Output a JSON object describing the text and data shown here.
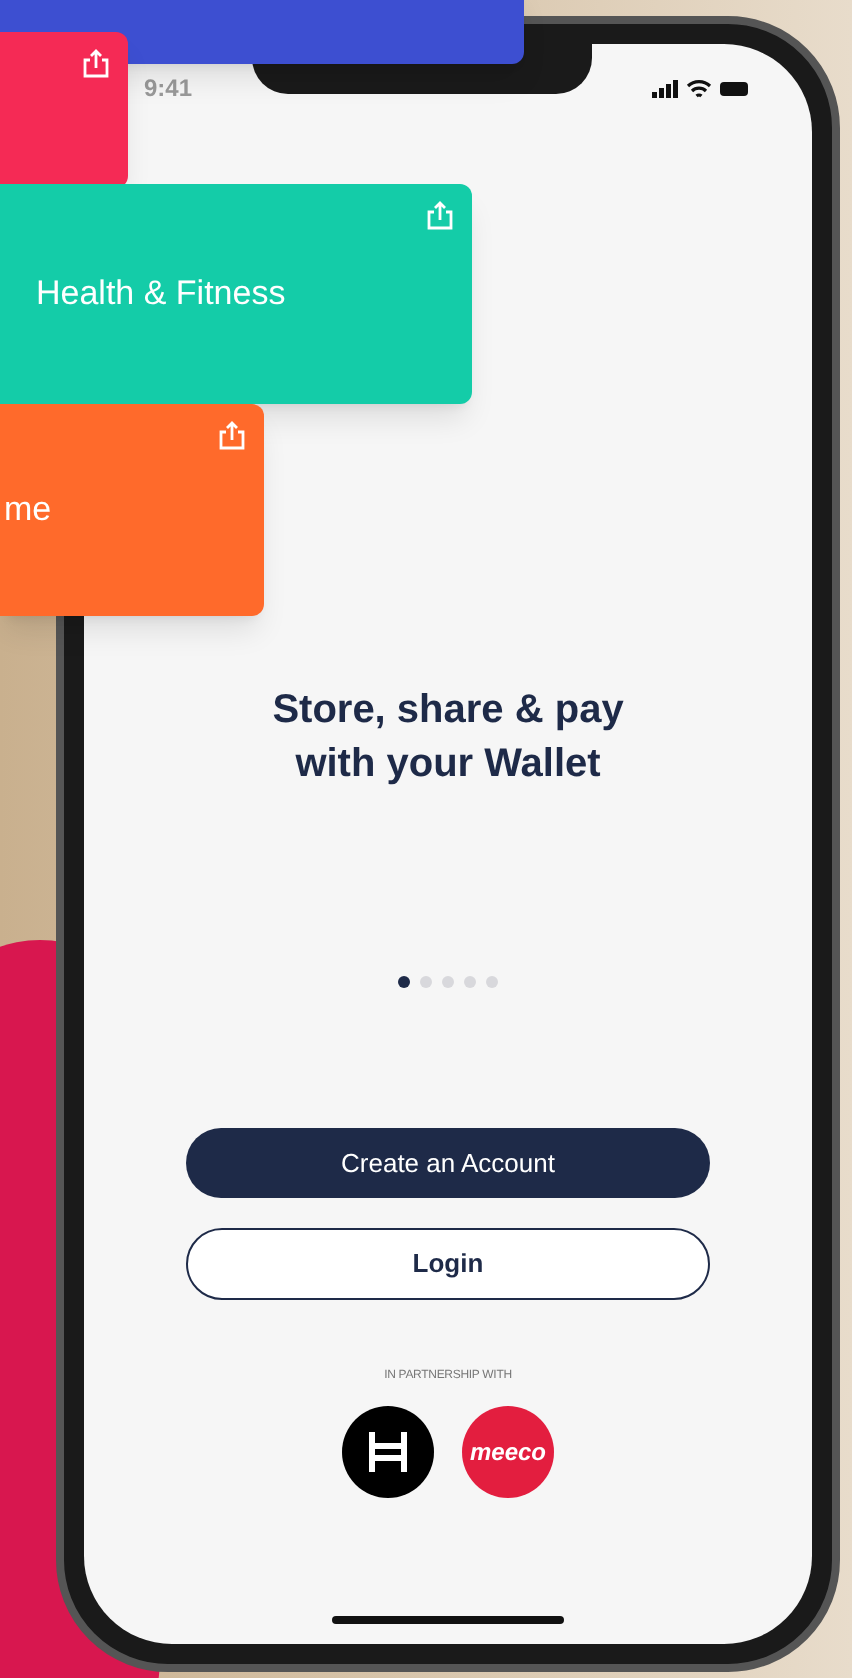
{
  "status_bar": {
    "time": "9:41"
  },
  "cards": [
    {
      "color": "#3d4fd1"
    },
    {
      "color": "#f52a55"
    },
    {
      "label": "Health & Fitness",
      "color": "#14cca8"
    },
    {
      "label": "me",
      "color": "#ff6a2b"
    }
  ],
  "headline": "Store, share & pay with your Wallet",
  "pager": [
    {
      "selected": true
    },
    {
      "selected": false
    },
    {
      "selected": false
    },
    {
      "selected": false
    },
    {
      "selected": false
    }
  ],
  "buttons": [
    {
      "label": "Create an Account",
      "kind": "primary"
    },
    {
      "label": "Login",
      "kind": "outline"
    }
  ],
  "partnership": {
    "caption": "IN PARTNERSHIP WITH",
    "partners": [
      {
        "kind": "h-mark"
      },
      {
        "kind": "wordmark",
        "text": "meeco"
      }
    ]
  }
}
